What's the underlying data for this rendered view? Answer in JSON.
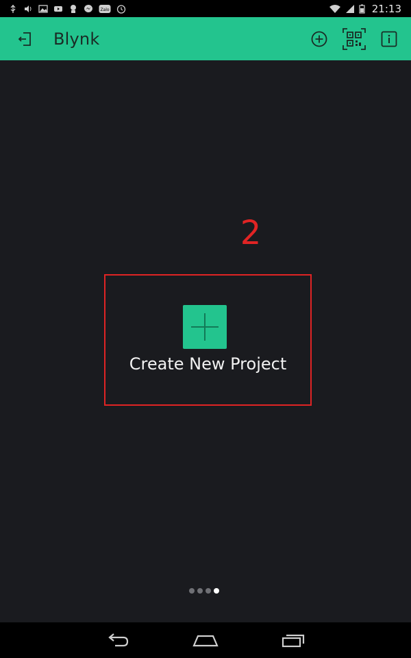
{
  "status_bar": {
    "time": "21:13",
    "icons": [
      "usb-icon",
      "volume-icon",
      "image-icon",
      "youtube-icon",
      "app-icon",
      "messenger-icon",
      "zalo-icon",
      "clock-icon",
      "wifi-icon",
      "signal-icon",
      "battery-icon"
    ],
    "zalo_text": "Zalo"
  },
  "app_bar": {
    "title": "Blynk",
    "icons": [
      "logout-icon",
      "add-circle-icon",
      "qr-code-icon",
      "info-icon"
    ],
    "color": "#23c48e"
  },
  "main": {
    "create_label": "Create New Project",
    "step_annotation": "2",
    "annotation_color": "#e12424",
    "page_indicator": {
      "total": 4,
      "active_index": 3
    }
  },
  "nav_bar": {
    "icons": [
      "back-icon",
      "home-icon",
      "recent-apps-icon"
    ]
  }
}
